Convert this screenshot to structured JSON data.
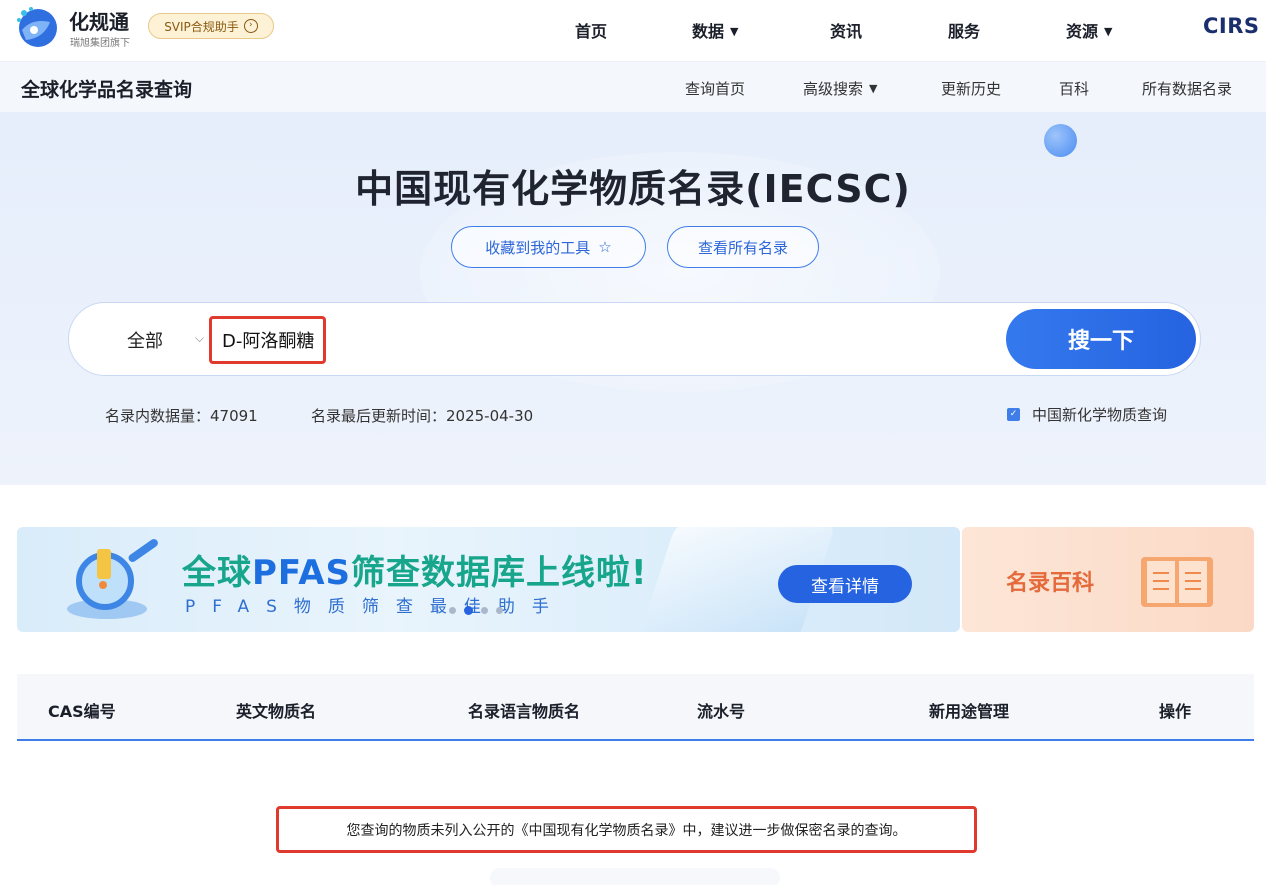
{
  "header": {
    "logo_title": "化规通",
    "logo_subtitle": "瑞旭集团旗下",
    "svip_label": "SVIP合规助手",
    "nav": [
      {
        "label": "首页"
      },
      {
        "label": "数据",
        "caret": "▼"
      },
      {
        "label": "资讯"
      },
      {
        "label": "服务"
      },
      {
        "label": "资源",
        "caret": "▼"
      }
    ],
    "brand": "CIRS"
  },
  "subnav": {
    "title": "全球化学品名录查询",
    "items": [
      "查询首页",
      "高级搜索",
      "更新历史",
      "百科",
      "所有数据名录"
    ],
    "advanced_caret": "▼"
  },
  "hero": {
    "title": "中国现有化学物质名录(IECSC)",
    "favorite_label": "收藏到我的工具",
    "favorite_icon": "☆",
    "view_all_label": "查看所有名录",
    "search": {
      "scope": "全部",
      "query": "D-阿洛酮糖",
      "button": "搜一下"
    },
    "stats": {
      "count_label": "名录内数据量：47091",
      "updated_label": "名录最后更新时间：2025-04-30"
    },
    "new_chem_label": "中国新化学物质查询"
  },
  "banner": {
    "title_part1": "全球",
    "title_part2": "PFAS",
    "title_part3": "筛查数据库上线啦!",
    "subtitle": "PFAS物质筛查最佳助手",
    "button": "查看详情",
    "slides": 4,
    "active_slide": 1
  },
  "wiki": {
    "label": "名录百科"
  },
  "table": {
    "columns": [
      "CAS编号",
      "英文物质名",
      "名录语言物质名",
      "流水号",
      "新用途管理",
      "操作"
    ]
  },
  "notice": "您查询的物质未列入公开的《中国现有化学物质名录》中，建议进一步做保密名录的查询。",
  "colors": {
    "accent": "#2563e0",
    "highlight_border": "#e03a2e",
    "banner_green": "#17a58c",
    "wiki_orange": "#e46a3b"
  }
}
